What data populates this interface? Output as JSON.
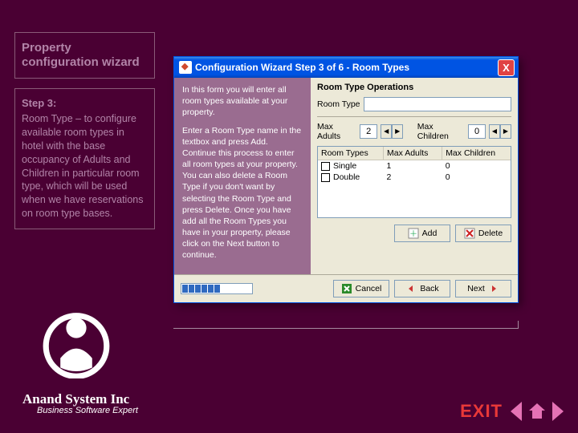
{
  "left": {
    "title": "Property configuration wizard",
    "step_label": "Step 3:",
    "step_body": "Room Type – to configure available room types in hotel with the base occupancy of Adults and Children in particular room type, which will be used when we have reservations on room type bases."
  },
  "footer": {
    "company": "Anand System Inc",
    "tagline": "Business Software Expert",
    "exit": "EXIT"
  },
  "window": {
    "title": "Configuration Wizard Step 3 of 6 - Room Types",
    "help": {
      "p1": "In this form you will enter all room types available at your property.",
      "p2": "Enter a Room Type name in the textbox and press Add. Continue this process to enter all room types at your property. You can also delete a Room Type if you don't want by selecting the Room Type and press Delete. Once you have add all the Room Types you have in your property, please click on the Next button to continue."
    },
    "form": {
      "section": "Room Type Operations",
      "room_type_label": "Room Type",
      "room_type_value": "",
      "max_adults_label": "Max Adults",
      "max_adults_value": "2",
      "max_children_label": "Max Children",
      "max_children_value": "0",
      "table": {
        "headers": [
          "Room Types",
          "Max Adults",
          "Max Children"
        ],
        "rows": [
          {
            "name": "Single",
            "adults": "1",
            "children": "0"
          },
          {
            "name": "Double",
            "adults": "2",
            "children": "0"
          }
        ]
      },
      "btn_add": "Add",
      "btn_delete": "Delete",
      "btn_cancel": "Cancel",
      "btn_back": "Back",
      "btn_next": "Next"
    }
  }
}
